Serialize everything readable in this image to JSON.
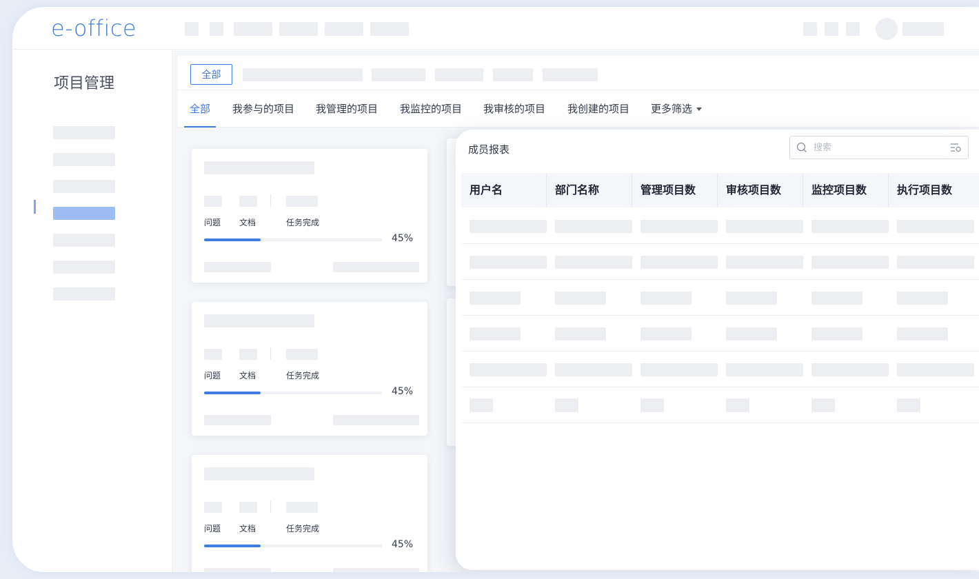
{
  "app": {
    "logo": "e-office"
  },
  "sidebar": {
    "title": "项目管理"
  },
  "filter": {
    "all_chip": "全部"
  },
  "tabs": [
    {
      "label": "全部",
      "active": true
    },
    {
      "label": "我参与的项目"
    },
    {
      "label": "我管理的项目"
    },
    {
      "label": "我监控的项目"
    },
    {
      "label": "我审核的项目"
    },
    {
      "label": "我创建的项目"
    },
    {
      "label": "更多筛选"
    }
  ],
  "cards": [
    {
      "stats": [
        "问题",
        "文档",
        "任务完成"
      ],
      "progress": 45,
      "progress_text": "45%"
    },
    {
      "stats": [
        "问题",
        "文档",
        "任务完成"
      ],
      "progress": 45,
      "progress_text": "45%"
    },
    {
      "stats": [
        "问题",
        "文档",
        "任务完成"
      ],
      "progress": 45,
      "progress_text": "45%"
    }
  ],
  "panel": {
    "title": "成员报表",
    "search_placeholder": "搜索",
    "columns": [
      "用户名",
      "部门名称",
      "管理项目数",
      "审核项目数",
      "监控项目数",
      "执行项目数"
    ]
  },
  "colors": {
    "accent": "#3f7ce0",
    "skeleton": "#eceef2"
  }
}
